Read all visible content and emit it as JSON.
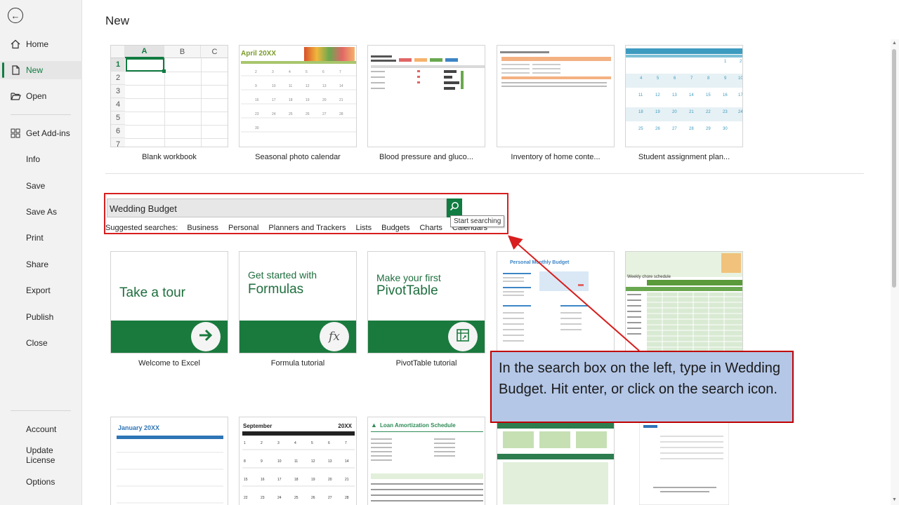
{
  "sidebar": {
    "back_icon": "arrow-left-icon",
    "items_top": [
      {
        "label": "Home",
        "icon": "home-icon",
        "active": false
      },
      {
        "label": "New",
        "icon": "new-document-icon",
        "active": true
      },
      {
        "label": "Open",
        "icon": "folder-open-icon",
        "active": false
      }
    ],
    "items_mid": [
      {
        "label": "Get Add-ins",
        "icon": "addins-grid-icon"
      },
      {
        "label": "Info"
      },
      {
        "label": "Save"
      },
      {
        "label": "Save As"
      },
      {
        "label": "Print"
      },
      {
        "label": "Share"
      },
      {
        "label": "Export"
      },
      {
        "label": "Publish"
      },
      {
        "label": "Close"
      }
    ],
    "items_bottom": [
      {
        "label": "Account"
      },
      {
        "label": "Update License"
      },
      {
        "label": "Options"
      }
    ]
  },
  "main": {
    "title": "New",
    "blank_workbook": {
      "columns": [
        "A",
        "B",
        "C"
      ],
      "rows": [
        "1",
        "2",
        "3",
        "4",
        "5",
        "6",
        "7"
      ]
    },
    "top_templates": [
      {
        "label": "Blank workbook"
      },
      {
        "label": "Seasonal photo calendar",
        "preview_title": "April 20XX"
      },
      {
        "label": "Blood pressure and gluco..."
      },
      {
        "label": "Inventory of home conte..."
      },
      {
        "label": "Student assignment plan..."
      }
    ],
    "search": {
      "value": "Wedding Budget",
      "button_icon": "search-icon",
      "tooltip": "Start searching",
      "suggested_label": "Suggested searches:",
      "suggestions": [
        "Business",
        "Personal",
        "Planners and Trackers",
        "Lists",
        "Budgets",
        "Charts",
        "Calendars"
      ]
    },
    "feature_tiles": [
      {
        "line1": "Take a tour",
        "line2": "",
        "label": "Welcome to Excel",
        "icon": "arrow-right-icon"
      },
      {
        "line1": "Get started with",
        "line2": "Formulas",
        "label": "Formula tutorial",
        "icon": "fx-icon"
      },
      {
        "line1": "Make your first",
        "line2": "PivotTable",
        "label": "PivotTable tutorial",
        "icon": "pivottable-icon"
      }
    ],
    "more_templates": [
      {
        "preview_title": "Personal Monthly Budget"
      },
      {
        "preview_title": "Weekly chore schedule"
      }
    ],
    "bottom_templates": [
      {
        "preview_title": "January 20XX"
      },
      {
        "preview_title": "September",
        "preview_year": "20XX"
      },
      {
        "preview_title": "Loan Amortization Schedule"
      },
      {
        "preview_title": ""
      },
      {
        "preview_title": ""
      }
    ]
  },
  "callout": {
    "text": "In the search box on the left, type in Wedding Budget. Hit enter, or click on the search icon.",
    "bg_color": "#b4c7e7",
    "border_color": "#c00000"
  },
  "colors": {
    "accent": "#107c41",
    "annotation_red": "#d81e1e"
  }
}
